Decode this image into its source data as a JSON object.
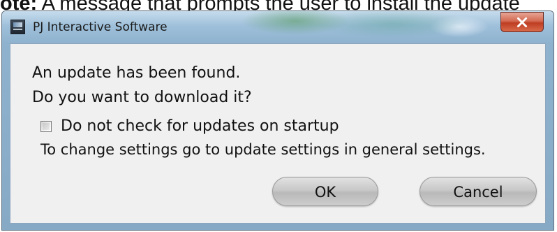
{
  "caption": {
    "prefix": "ote:",
    "text": " A message that prompts the user to install the update"
  },
  "window": {
    "title": "PJ Interactive Software",
    "close_label": "x"
  },
  "dialog": {
    "message_line1": "An update has been found.",
    "message_line2": "Do you want to download it?",
    "checkbox_label": "Do not check for updates on startup",
    "checkbox_checked": false,
    "settings_hint": "To change settings go to update settings in general settings.",
    "ok_label": "OK",
    "cancel_label": "Cancel"
  },
  "colors": {
    "titlebar": "#9fc0da",
    "close_button": "#c8452b",
    "client_background": "#f0f0f0"
  },
  "icons": {
    "app": "app-icon",
    "close": "close-icon"
  }
}
